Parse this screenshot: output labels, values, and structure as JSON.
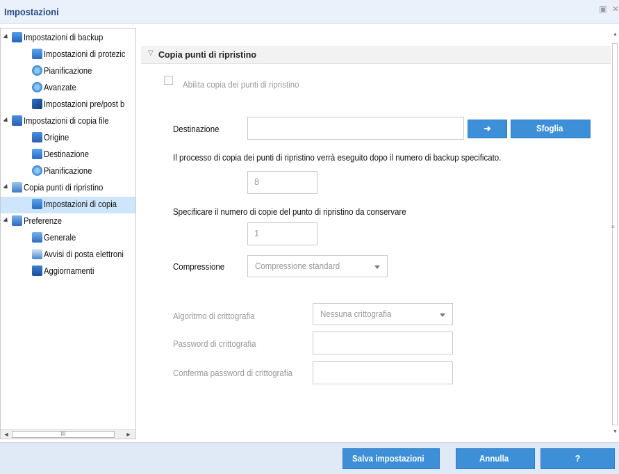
{
  "window": {
    "title": "Impostazioni",
    "controls": [
      "restore-icon",
      "close-icon"
    ],
    "close_glyph": "✕"
  },
  "tree": {
    "items": [
      {
        "label": "Impostazioni di backup",
        "icon": "backup-settings-icon",
        "level": 0,
        "expanded": true
      },
      {
        "label": "Impostazioni di protezic",
        "icon": "protection-settings-icon",
        "level": 1
      },
      {
        "label": "Pianificazione",
        "icon": "schedule-icon",
        "level": 1
      },
      {
        "label": "Avanzate",
        "icon": "advanced-icon",
        "level": 1
      },
      {
        "label": "Impostazioni pre/post b",
        "icon": "wrench-icon",
        "level": 1
      },
      {
        "label": "Impostazioni di copia file",
        "icon": "file-copy-settings-icon",
        "level": 0,
        "expanded": true
      },
      {
        "label": "Origine",
        "icon": "source-icon",
        "level": 1
      },
      {
        "label": "Destinazione",
        "icon": "destination-icon",
        "level": 1
      },
      {
        "label": "Pianificazione",
        "icon": "schedule-icon",
        "level": 1
      },
      {
        "label": "Copia punti di ripristino",
        "icon": "copy-recovery-points-icon",
        "level": 0,
        "expanded": true
      },
      {
        "label": "Impostazioni di copia",
        "icon": "copy-settings-icon",
        "level": 1,
        "selected": true
      },
      {
        "label": "Preferenze",
        "icon": "preferences-icon",
        "level": 0,
        "expanded": true
      },
      {
        "label": "Generale",
        "icon": "general-icon",
        "level": 1
      },
      {
        "label": "Avvisi di posta elettroni",
        "icon": "mail-alerts-icon",
        "level": 1
      },
      {
        "label": "Aggiornamenti",
        "icon": "updates-icon",
        "level": 1
      }
    ],
    "scrollbar_thumb_glyph": "III"
  },
  "section": {
    "title": "Copia punti di ripristino",
    "enable_checkbox_label": "Abilita copia dei punti di ripristino",
    "enable_checked": false
  },
  "form": {
    "destination_label": "Destinazione",
    "destination_value": "",
    "arrow_button_glyph": "➜",
    "browse_label": "Sfoglia",
    "process_note": "Il processo di copia dei punti di ripristino verrà eseguito dopo il numero di backup specificato.",
    "backup_count": "8",
    "copies_note": "Specificare il numero di copie del punto di ripristino da conservare",
    "copies_count": "1",
    "compression_label": "Compressione",
    "compression_value": "Compressione standard",
    "encryption_algorithm_label": "Algoritmo di crittografia",
    "encryption_algorithm_value": "Nessuna crittografia",
    "encryption_password_label": "Password di crittografia",
    "encryption_password_value": "",
    "confirm_password_label": "Conferma password di crittografia",
    "confirm_password_value": ""
  },
  "footer": {
    "save_label": "Salva impostazioni",
    "cancel_label": "Annulla",
    "help_label": "?"
  },
  "colors": {
    "accent": "#3d8fd8",
    "title_text": "#2a4a86",
    "selected_row": "#cfe5fb",
    "footer_bg": "#dfeaf6"
  }
}
